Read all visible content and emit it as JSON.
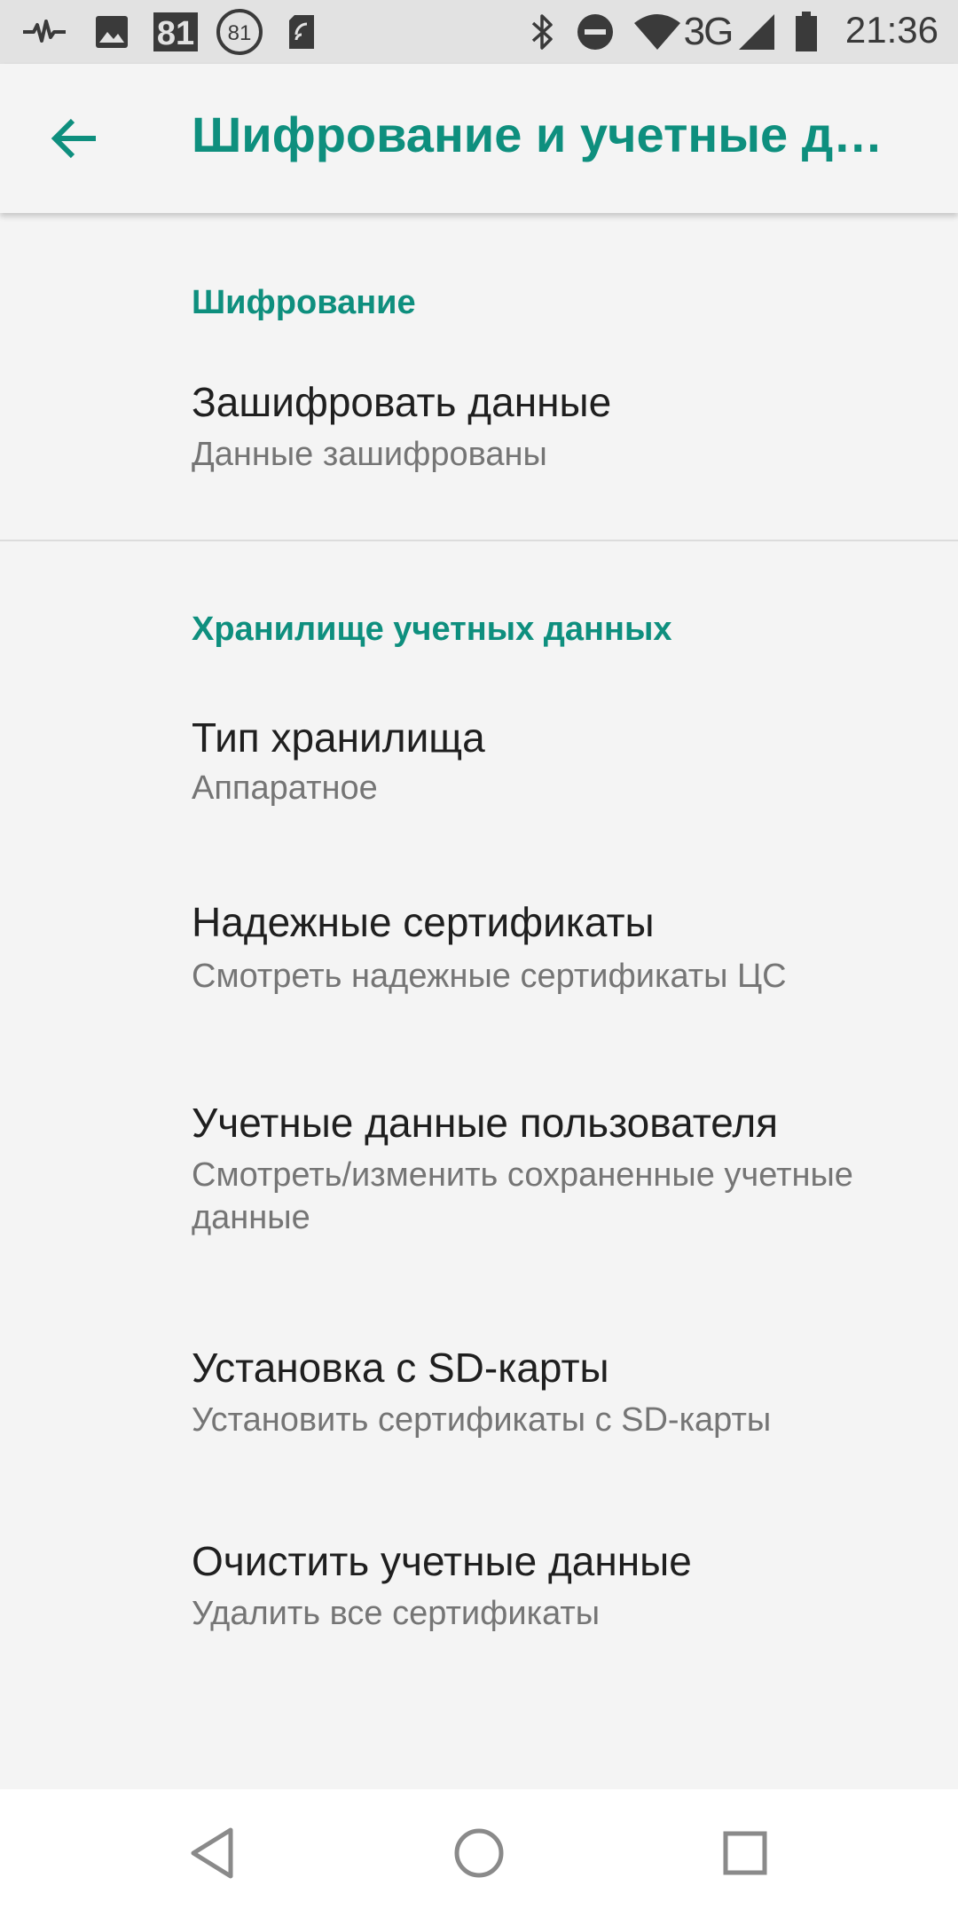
{
  "status_bar": {
    "time": "21:36",
    "notification_badge_1": "81",
    "notification_badge_2": "81",
    "network_label": "3G",
    "icons": [
      "pulse-icon",
      "image-icon",
      "badge-81-icon",
      "circle-81-icon",
      "nfc-card-icon",
      "bluetooth-icon",
      "do-not-disturb-icon",
      "wifi-icon",
      "signal-icon",
      "battery-icon"
    ]
  },
  "toolbar": {
    "title": "Шифрование и учетные данные",
    "back_icon": "arrow-back-icon"
  },
  "sections": {
    "encryption": {
      "header": "Шифрование",
      "items": [
        {
          "title": "Зашифровать данные",
          "summary": "Данные зашифрованы"
        }
      ]
    },
    "credential_storage": {
      "header": "Хранилище учетных данных",
      "items": [
        {
          "title": "Тип хранилища",
          "summary": "Аппаратное"
        },
        {
          "title": "Надежные сертификаты",
          "summary": "Смотреть надежные сертификаты ЦС"
        },
        {
          "title": "Учетные данные пользователя",
          "summary": "Смотреть/изменить сохраненные учетные данные"
        },
        {
          "title": "Установка с SD-карты",
          "summary": "Установить сертификаты с SD-карты"
        },
        {
          "title": "Очистить учетные данные",
          "summary": "Удалить все сертификаты"
        }
      ]
    }
  },
  "nav_bar": {
    "icons": [
      "back-triangle-icon",
      "home-circle-icon",
      "recents-square-icon"
    ]
  },
  "colors": {
    "accent": "#0e8f7e",
    "background": "#f4f4f4",
    "status_bar": "#e2e2e2",
    "title_text": "#1f1f1f",
    "summary_text": "#757575"
  }
}
